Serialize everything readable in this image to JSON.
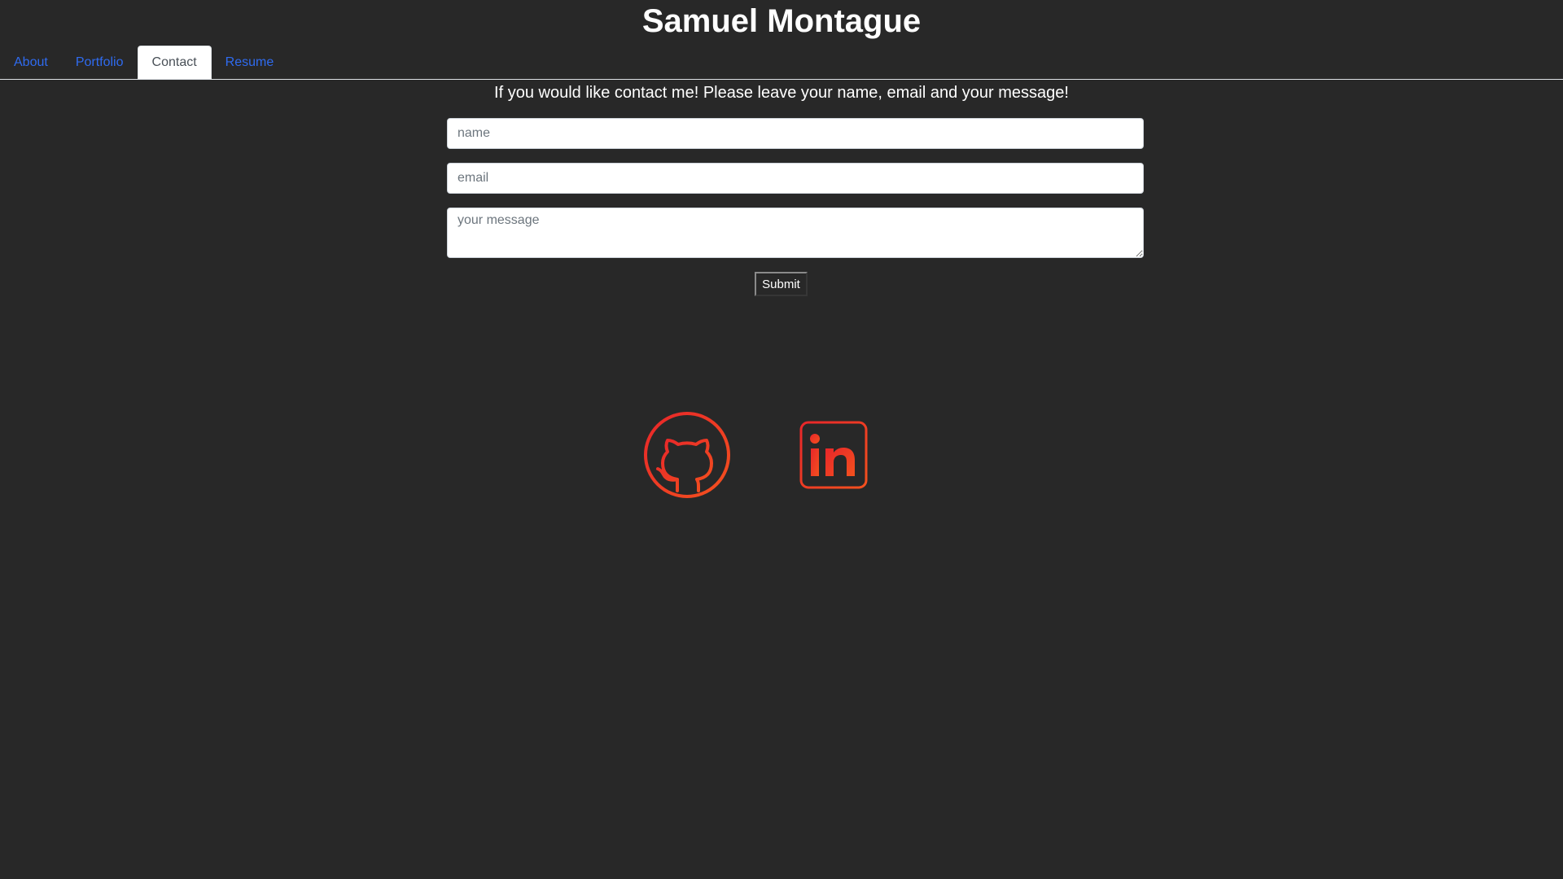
{
  "header": {
    "title": "Samuel Montague"
  },
  "nav": {
    "tabs": [
      {
        "label": "About"
      },
      {
        "label": "Portfolio"
      },
      {
        "label": "Contact",
        "active": true
      },
      {
        "label": "Resume"
      }
    ]
  },
  "contact": {
    "intro": "If you would like contact me! Please leave your name, email and your message!",
    "name_placeholder": "name",
    "email_placeholder": "email",
    "message_placeholder": "your message",
    "submit_label": "Submit"
  },
  "social": {
    "icons": [
      "github-icon",
      "linkedin-icon"
    ],
    "accent_colors": [
      "#e8262a",
      "#f4511e"
    ]
  },
  "colors": {
    "background": "#282828",
    "link": "#2f6bf0",
    "text": "#ffffff"
  }
}
